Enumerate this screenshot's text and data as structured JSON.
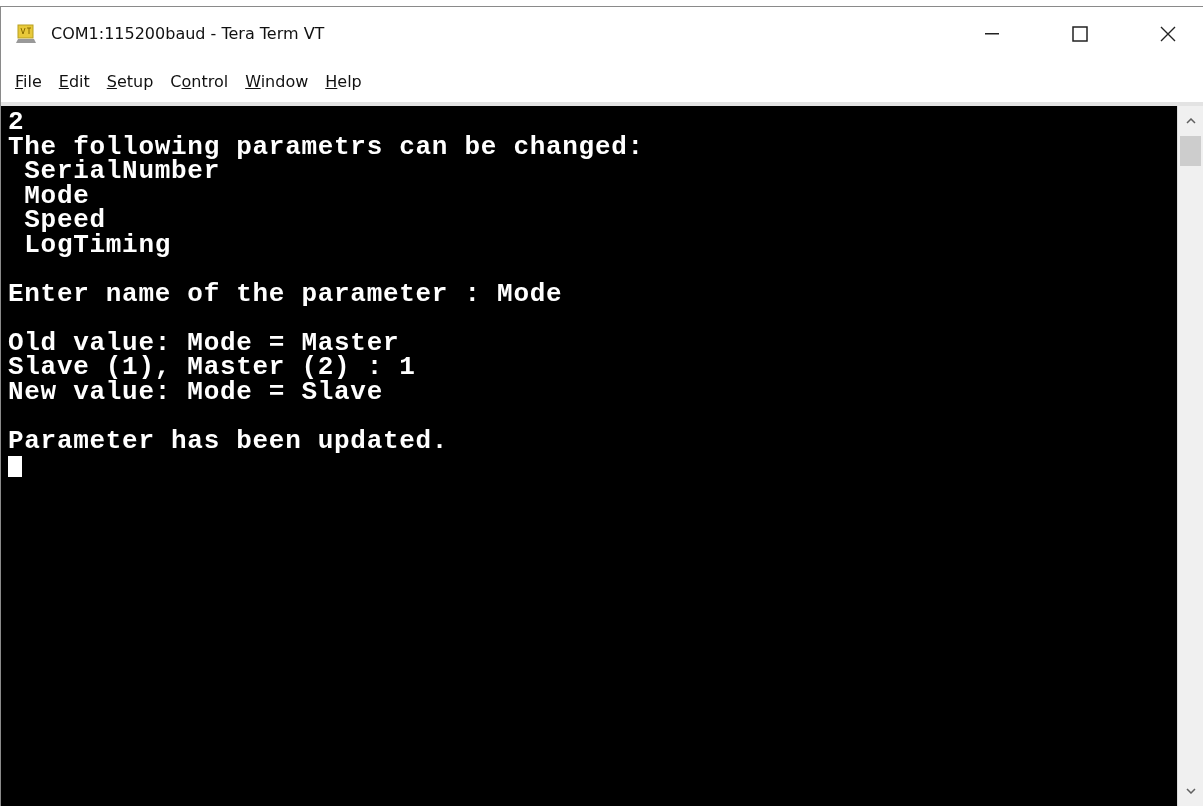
{
  "window": {
    "title": "COM1:115200baud - Tera Term VT"
  },
  "menu": [
    {
      "key": "F",
      "post": "ile"
    },
    {
      "key": "E",
      "post": "dit"
    },
    {
      "key": "S",
      "post": "etup"
    },
    {
      "pre": "C",
      "key": "o",
      "post": "ntrol"
    },
    {
      "key": "W",
      "post": "indow"
    },
    {
      "key": "H",
      "post": "elp"
    }
  ],
  "terminal": {
    "blocks": [
      [
        "2",
        "The following parametrs can be changed:",
        " SerialNumber",
        " Mode",
        " Speed",
        " LogTiming"
      ],
      [
        "Enter name of the parameter : Mode"
      ],
      [
        "Old value: Mode = Master",
        "Slave (1), Master (2) : 1",
        "New value: Mode = Slave"
      ],
      [
        "Parameter has been updated."
      ]
    ],
    "cursor": true
  }
}
